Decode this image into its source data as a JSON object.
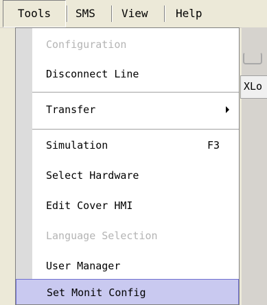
{
  "menubar": {
    "tools": "Tools",
    "sms": "SMS",
    "view": "View",
    "help": "Help"
  },
  "background": {
    "panel_text": "XLo"
  },
  "menu": {
    "items": [
      {
        "label": "Configuration",
        "disabled": true
      },
      {
        "label": "Disconnect Line"
      },
      {
        "label": "Transfer",
        "submenu": true
      },
      {
        "label": "Simulation",
        "shortcut": "F3"
      },
      {
        "label": "Select Hardware"
      },
      {
        "label": "Edit Cover HMI"
      },
      {
        "label": "Language Selection",
        "disabled": true
      },
      {
        "label": "User Manager"
      },
      {
        "label": "Set Monit Config",
        "selected": true
      }
    ]
  },
  "colors": {
    "menubar_bg": "#ece9d8",
    "highlight_bg": "#c9c9f0",
    "highlight_border": "#6f6fd0",
    "disabled_text": "#b4b4b4"
  }
}
